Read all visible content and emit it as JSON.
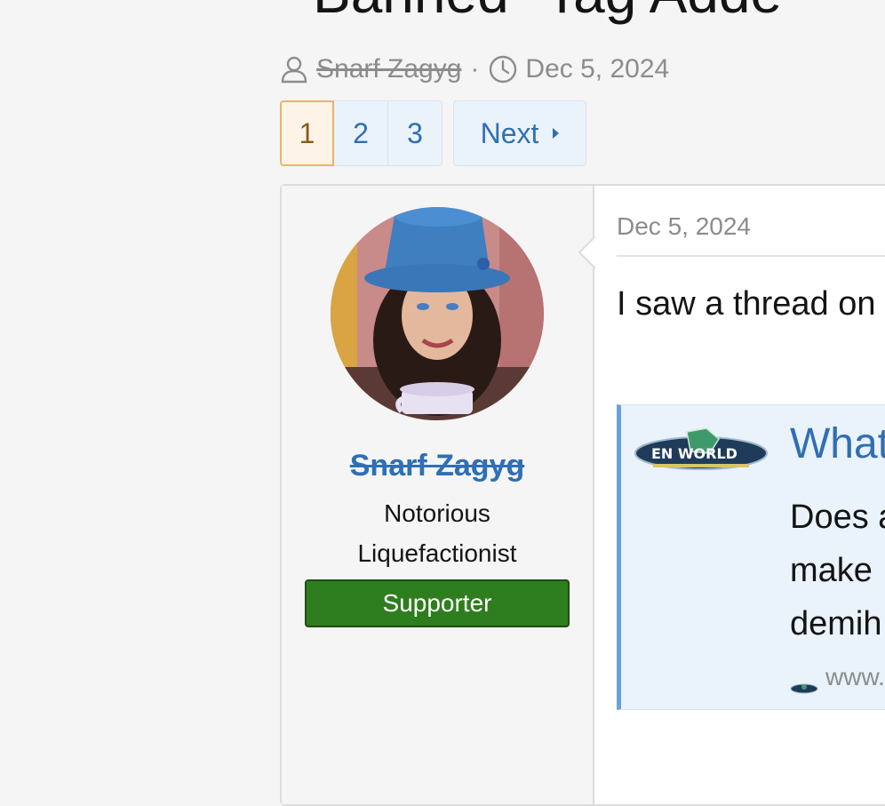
{
  "page": {
    "title": "Banned \"Tag Adde",
    "author": "Snarf Zagyg",
    "separator": "·",
    "date": "Dec 5, 2024"
  },
  "pagination": {
    "pages": [
      "1",
      "2",
      "3"
    ],
    "current": "1",
    "next_label": "Next"
  },
  "post": {
    "user": {
      "name": "Snarf Zagyg",
      "title_line1": "Notorious",
      "title_line2": "Liquefactionist",
      "banner": "Supporter"
    },
    "date": "Dec 5, 2024",
    "text": "I saw a thread on",
    "embed": {
      "logo_text": "EN WORLD",
      "title": "What",
      "snippet": [
        "Does a",
        "make",
        "demih"
      ],
      "source": "www."
    }
  },
  "colors": {
    "link": "#2f6fb3",
    "muted": "#8c8c8c",
    "supporter_banner": "#2e7d1e",
    "current_page_bg": "#fdf4e7",
    "current_page_border": "#e7b56c",
    "embed_bar": "#6aa3da"
  },
  "icons": {
    "author": "user-icon",
    "date": "clock-icon",
    "next": "caret-right-icon"
  }
}
